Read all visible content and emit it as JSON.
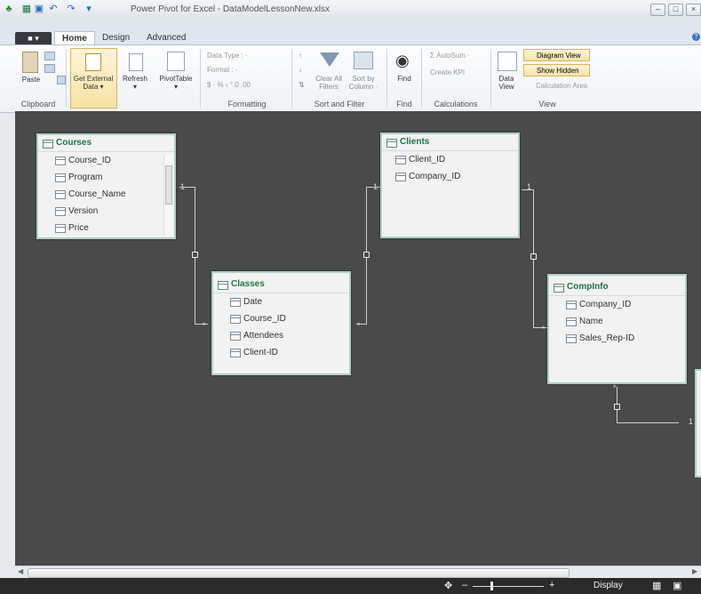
{
  "window": {
    "title": "Power Pivot for Excel - DataModelLessonNew.xlsx"
  },
  "tabs": {
    "file": "■ ▾",
    "home": "Home",
    "design": "Design",
    "advanced": "Advanced"
  },
  "ribbon": {
    "paste": "Paste",
    "get_external_data": [
      "Get External",
      "Data ▾"
    ],
    "refresh": [
      "Refresh",
      "▾"
    ],
    "pivottable": [
      "PivotTable",
      "▾"
    ],
    "data_type": "Data Type : ·",
    "format": "Format : ·",
    "number_format": "$ · % ‹ °.0 .00",
    "clear_all_filters": [
      "Clear All",
      "Filters"
    ],
    "sort_by_column": [
      "Sort by",
      "Column ·"
    ],
    "find": "Find",
    "autosum": "Σ AutoSum ·",
    "create_kpi": "Create KPI",
    "data_view": [
      "Data",
      "View"
    ],
    "diagram_view": "Diagram View",
    "show_hidden": "Show Hidden",
    "calculation_area": "Calculation Area",
    "groups": {
      "clipboard": "Clipboard",
      "formatting": "Formatting",
      "sort_filter": "Sort and Filter",
      "find": "Find",
      "calculations": "Calculations",
      "view": "View"
    }
  },
  "tables": [
    {
      "name": "Courses",
      "fields": [
        "Course_ID",
        "Program",
        "Course_Name",
        "Version",
        "Price"
      ]
    },
    {
      "name": "Clients",
      "fields": [
        "Client_ID",
        "Company_ID"
      ]
    },
    {
      "name": "Classes",
      "fields": [
        "Date",
        "Course_ID",
        "Attendees",
        "Client-ID"
      ]
    },
    {
      "name": "CompInfo",
      "fields": [
        "Company_ID",
        "Name",
        "Sales_Rep-ID"
      ]
    }
  ],
  "relationships": {
    "one": "1",
    "many": "*"
  },
  "status": {
    "display": "Display"
  }
}
